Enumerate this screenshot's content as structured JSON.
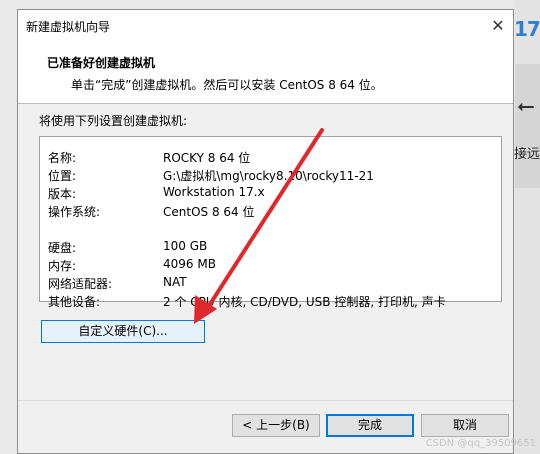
{
  "background_app": {
    "number_text": "17",
    "back_icon": "back-arrow-icon",
    "partial_text": "接远"
  },
  "dialog": {
    "title": "新建虚拟机向导",
    "close_icon": "close-icon",
    "header": {
      "title": "已准备好创建虚拟机",
      "subtitle": "单击“完成”创建虚拟机。然后可以安装 CentOS 8 64 位。"
    },
    "intro": "将使用下列设置创建虚拟机:",
    "settings": [
      {
        "label": "名称:",
        "value": "ROCKY 8 64 位"
      },
      {
        "label": "位置:",
        "value": "G:\\虚拟机\\mg\\rocky8.10\\rocky11-21"
      },
      {
        "label": "版本:",
        "value": "Workstation 17.x"
      },
      {
        "label": "操作系统:",
        "value": "CentOS 8 64 位"
      },
      {
        "label": "硬盘:",
        "value": "100 GB"
      },
      {
        "label": "内存:",
        "value": "4096 MB"
      },
      {
        "label": "网络适配器:",
        "value": "NAT"
      },
      {
        "label": "其他设备:",
        "value": "2 个 CPU 内核, CD/DVD, USB 控制器, 打印机, 声卡"
      }
    ],
    "buttons": {
      "customize": "自定义硬件(C)...",
      "back": "< 上一步(B)",
      "finish": "完成",
      "cancel": "取消"
    }
  },
  "annotation": {
    "arrow_color": "#e0282c"
  },
  "watermark": "CSDN @qq_39509651"
}
